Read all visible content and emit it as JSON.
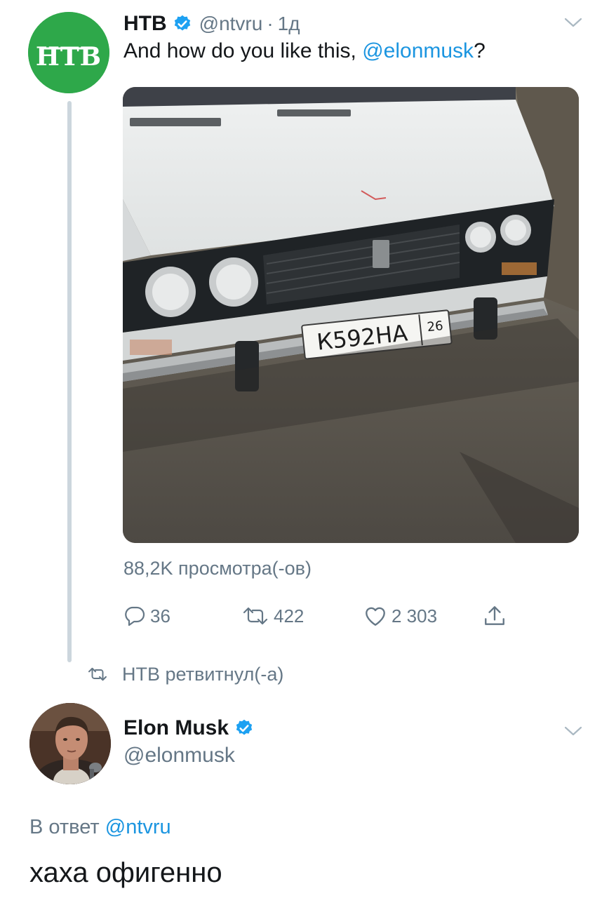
{
  "colors": {
    "accent": "#1b95e0",
    "secondary_text": "#657786",
    "verified": "#1da1f2",
    "ntv_green": "#2ea84a"
  },
  "tweet": {
    "avatar_logo": "НТВ",
    "display_name": "НТВ",
    "handle": "@ntvru",
    "separator": "·",
    "time": "1д",
    "text_before": "And how do you like this, ",
    "mention": "@elonmusk",
    "text_after": "?",
    "media": {
      "plate_number": "К592НА",
      "plate_region": "26"
    },
    "views": "88,2K просмотра(-ов)",
    "actions": {
      "replies": "36",
      "retweets": "422",
      "likes": "2 303"
    }
  },
  "retweet_notice": "НТВ ретвитнул(-а)",
  "reply": {
    "display_name": "Elon Musk",
    "handle": "@elonmusk",
    "reply_prefix": "В ответ ",
    "reply_to": "@ntvru",
    "text": "хаха офигенно"
  }
}
